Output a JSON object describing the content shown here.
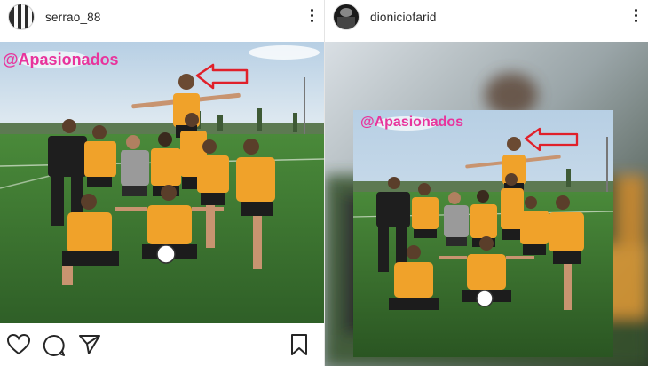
{
  "posts": [
    {
      "username": "serrao_88",
      "photo_caption_overlay": "@Apasionados",
      "icons": [
        "heart-icon",
        "comment-icon",
        "share-icon",
        "bookmark-icon"
      ]
    },
    {
      "username": "dioniciofarid",
      "photo_caption_overlay": "@Apasionados"
    }
  ],
  "colors": {
    "tag_pink": "#e8349c",
    "jersey_orange": "#f0a22a",
    "arrow_red": "#e0202a",
    "pitch_green": "#3f7a34",
    "sky": "#c9dcea"
  }
}
